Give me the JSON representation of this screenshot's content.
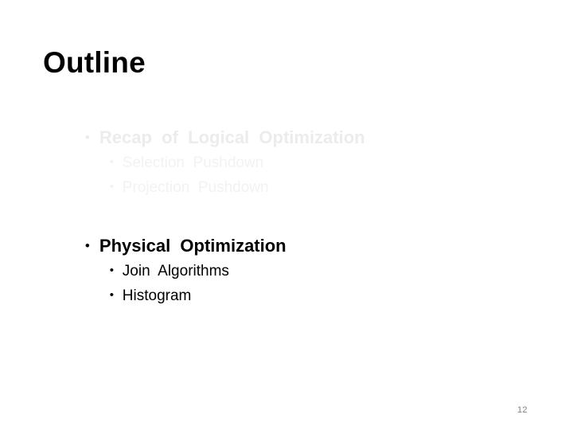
{
  "slide": {
    "title": "Outline",
    "page_number": "12",
    "background_color": "#ffffff",
    "title_color": "#000000",
    "faded_level1_color": "#ececec",
    "faded_level2_color": "#f2f2f2",
    "active_color": "#000000",
    "page_number_color": "#808080",
    "bullet_glyph": "•"
  },
  "outline": {
    "groups": [
      {
        "state": "faded",
        "heading": "Recap  of  Logical  Optimization",
        "items": [
          "Selection  Pushdown",
          "Projection  Pushdown"
        ]
      },
      {
        "state": "active",
        "heading": "Physical  Optimization",
        "items": [
          "Join  Algorithms",
          "Histogram"
        ]
      }
    ]
  }
}
